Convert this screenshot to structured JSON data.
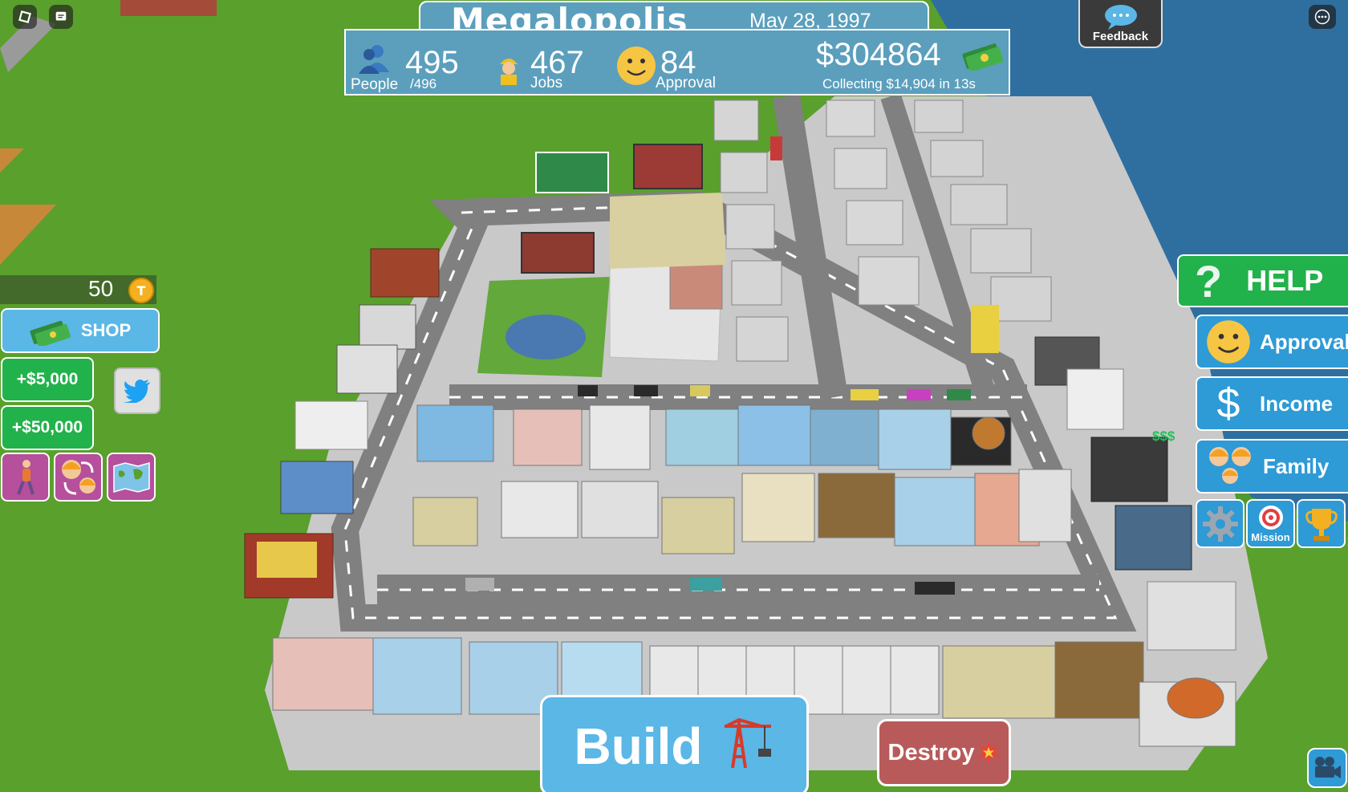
{
  "header": {
    "title": "Megalopolis",
    "date": "May 28, 1997"
  },
  "stats": {
    "people_value": "495",
    "people_label": "People",
    "people_capacity": "/496",
    "jobs_value": "467",
    "jobs_label": "Jobs",
    "approval_value": "84",
    "approval_label": "Approval",
    "money_value": "$304864",
    "collecting_text": "Collecting $14,904 in 13s"
  },
  "feedback": {
    "label": "Feedback"
  },
  "left_panel": {
    "coins": "50",
    "shop_label": "SHOP",
    "plus_5k_label": "+$5,000",
    "plus_50k_label": "+$50,000"
  },
  "right_panel": {
    "help_label": "HELP",
    "approval_label": "Approval",
    "income_label": "Income",
    "family_label": "Family",
    "mission_label": "Mission"
  },
  "bottom": {
    "build_label": "Build",
    "destroy_label": "Destroy"
  },
  "world": {
    "floating_money": "$$$"
  },
  "colors": {
    "grass": "#5aa02c",
    "water": "#2f6fa0",
    "road": "#8a8a8a",
    "panel_blue": "#5b9fbd",
    "button_blue": "#5ab7e6",
    "button_green": "#22b24c",
    "button_pink": "#b64f9c",
    "destroy_red": "#b95a5a"
  }
}
